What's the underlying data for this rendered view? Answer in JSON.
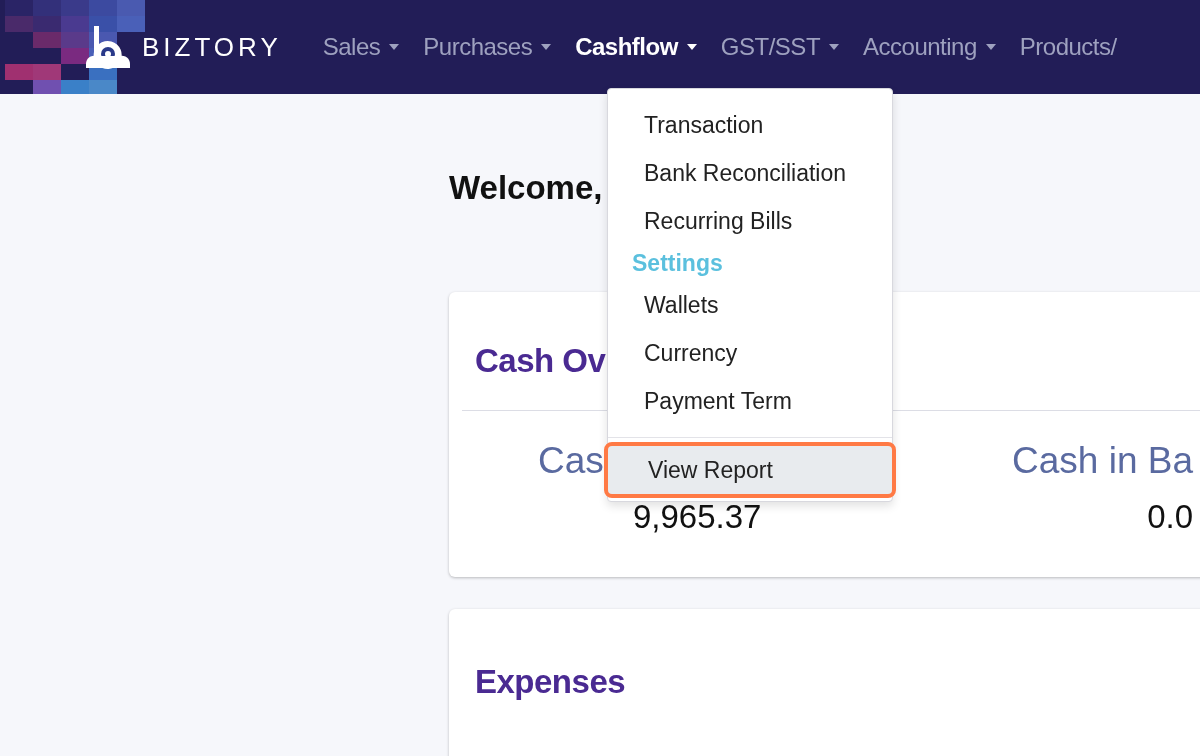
{
  "header": {
    "brand": "BIZTORY",
    "nav": [
      {
        "label": "Sales",
        "selected": false,
        "caret": true
      },
      {
        "label": "Purchases",
        "selected": false,
        "caret": true
      },
      {
        "label": "Cashflow",
        "selected": true,
        "caret": true
      },
      {
        "label": "GST/SST",
        "selected": false,
        "caret": true
      },
      {
        "label": "Accounting",
        "selected": false,
        "caret": true
      },
      {
        "label": "Products/",
        "selected": false,
        "caret": false
      }
    ]
  },
  "dropdown": {
    "items": [
      {
        "kind": "item",
        "label": "Transaction",
        "selected": false
      },
      {
        "kind": "item",
        "label": "Bank Reconciliation",
        "selected": false
      },
      {
        "kind": "item",
        "label": "Recurring Bills",
        "selected": false
      },
      {
        "kind": "heading",
        "label": "Settings"
      },
      {
        "kind": "item",
        "label": "Wallets",
        "selected": false
      },
      {
        "kind": "item",
        "label": "Currency",
        "selected": false
      },
      {
        "kind": "item",
        "label": "Payment Term",
        "selected": false
      },
      {
        "kind": "divider"
      },
      {
        "kind": "item",
        "label": "View Report",
        "selected": true
      }
    ]
  },
  "welcome": "Welcome,",
  "cash_card": {
    "title": "Cash Ov",
    "columns": [
      {
        "label": "Cas",
        "value": "9,965.37"
      },
      {
        "label": "Cash in Ba",
        "value": "0.0"
      }
    ]
  },
  "expenses_card": {
    "title": "Expenses"
  }
}
